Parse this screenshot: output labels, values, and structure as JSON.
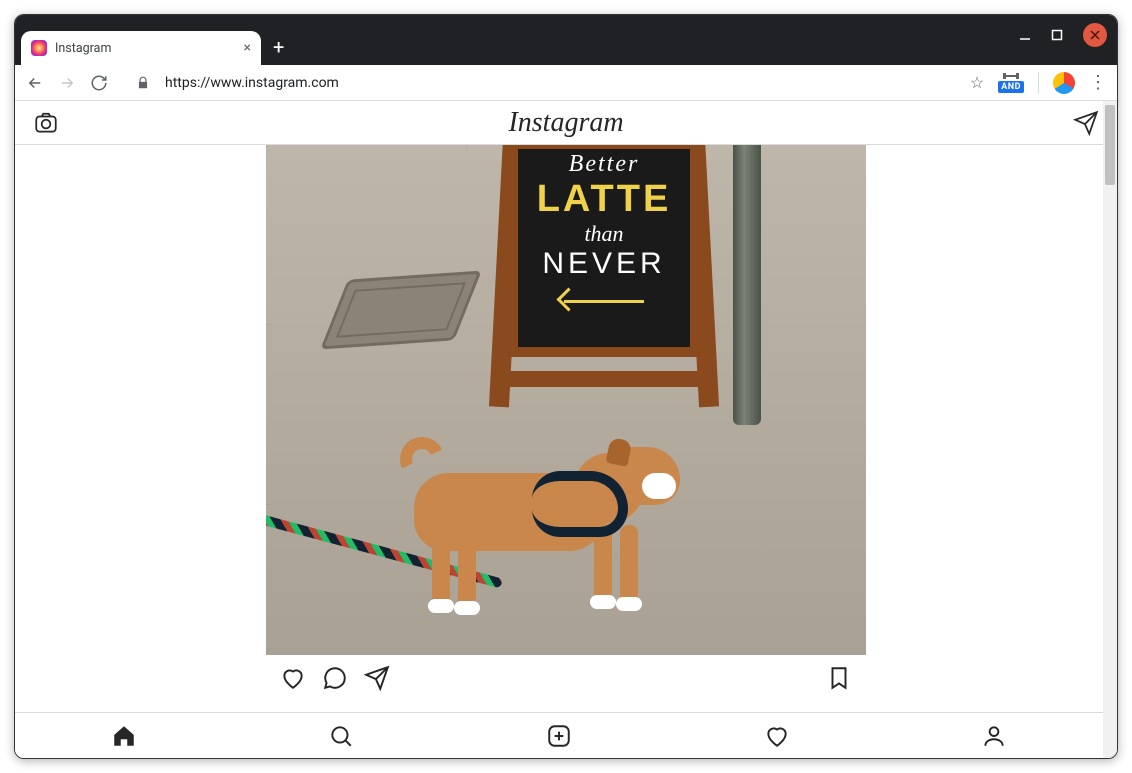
{
  "browser": {
    "tab_title": "Instagram",
    "url": "https://www.instagram.com",
    "ext_badge": "AND"
  },
  "page": {
    "brand": "Instagram",
    "chalkboard": {
      "line1": "Better",
      "line2": "LATTE",
      "line3": "than",
      "line4": "NEVER"
    }
  }
}
